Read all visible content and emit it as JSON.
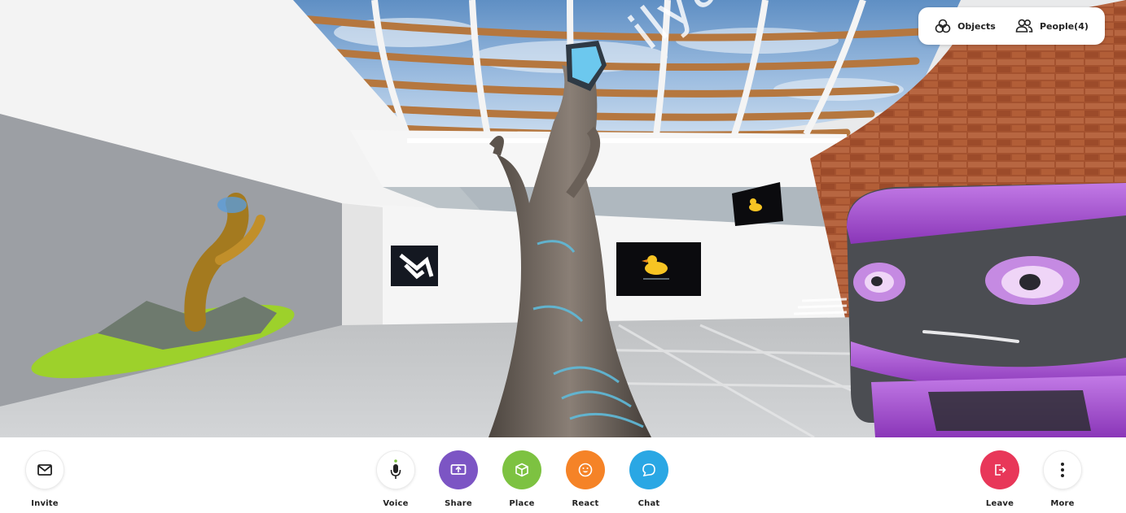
{
  "scene": {
    "room_text": "ilyaS",
    "colors": {
      "floor": "#c9cbcd",
      "wall_white": "#f2f2f2",
      "wall_grey": "#9c9fa4",
      "sky": "#6f9ccc",
      "beam": "#b5773f",
      "brick": "#a4522f",
      "robot_purple": "#a54fd0",
      "robot_face": "#4b4d52",
      "tree_bark": "#6f655d",
      "tree_glow": "#5fbad9",
      "moss": "#9dd12b"
    },
    "objects": [
      "tree-sculpture",
      "moss-island-art",
      "staircase-logo-art",
      "rubber-duck-art",
      "rubber-duck-art-upper",
      "robot-avatar"
    ]
  },
  "top_panel": {
    "objects_label": "Objects",
    "people_label": "People(4)"
  },
  "toolbar": {
    "invite": {
      "label": "Invite",
      "icon": "mail-icon"
    },
    "voice": {
      "label": "Voice",
      "icon": "microphone-icon"
    },
    "share": {
      "label": "Share",
      "icon": "screen-share-icon",
      "color": "#7c55c4"
    },
    "place": {
      "label": "Place",
      "icon": "cube-icon",
      "color": "#7dc241"
    },
    "react": {
      "label": "React",
      "icon": "emoji-icon",
      "color": "#f58327"
    },
    "chat": {
      "label": "Chat",
      "icon": "chat-bubble-icon",
      "color": "#2aa7e4"
    },
    "leave": {
      "label": "Leave",
      "icon": "exit-icon",
      "color": "#e83759"
    },
    "more": {
      "label": "More",
      "icon": "more-vertical-icon"
    },
    "voice_active_color": "#7dc241"
  }
}
